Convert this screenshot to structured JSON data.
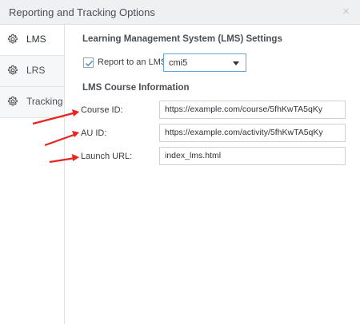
{
  "window": {
    "title": "Reporting and Tracking Options",
    "close_glyph": "×"
  },
  "sidebar": {
    "items": [
      {
        "label": "LMS",
        "icon": "gear-icon",
        "active": true
      },
      {
        "label": "LRS",
        "icon": "gear-icon",
        "active": false
      },
      {
        "label": "Tracking",
        "icon": "gear-icon",
        "active": false
      }
    ]
  },
  "lms_settings": {
    "heading": "Learning Management System (LMS) Settings",
    "report_checkbox_label": "Report to an LMS",
    "report_checked": true,
    "lms_standard": "cmi5"
  },
  "course_info": {
    "heading": "LMS Course Information",
    "course_id_label": "Course ID:",
    "course_id_value": "https://example.com/course/5fhKwTA5qKy",
    "au_id_label": "AU ID:",
    "au_id_value": "https://example.com/activity/5fhKwTA5qKy",
    "launch_url_label": "Launch URL:",
    "launch_url_value": "index_lms.html"
  },
  "annotation_color": "#e8241c",
  "accent_color": "#5fa3d8"
}
